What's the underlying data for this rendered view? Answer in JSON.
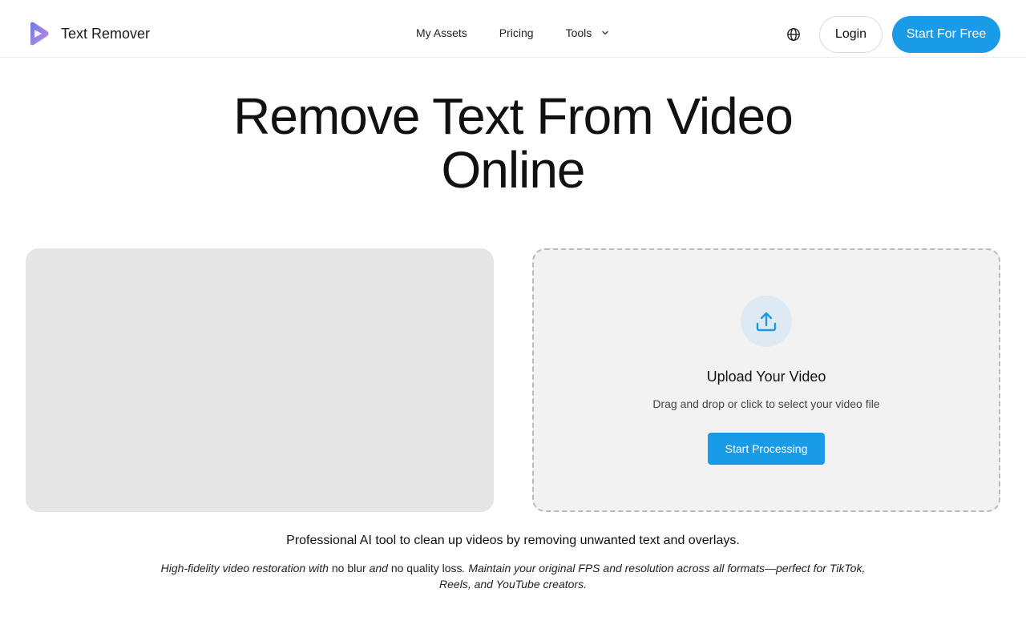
{
  "header": {
    "brand_name": "Text Remover",
    "nav": {
      "my_assets": "My Assets",
      "pricing": "Pricing",
      "tools": "Tools"
    },
    "login_label": "Login",
    "start_label": "Start For Free"
  },
  "hero": {
    "title_line1": "Remove Text From Video",
    "title_line2": "Online"
  },
  "upload": {
    "title": "Upload Your Video",
    "subtitle": "Drag and drop or click to select your video file",
    "button_label": "Start Processing"
  },
  "description": {
    "main": "Professional AI tool to clean up videos by removing unwanted text and overlays.",
    "sub": {
      "part1": "High-fidelity video restoration with ",
      "part2": "no blur",
      "part3": " and ",
      "part4": "no quality loss",
      "part5": ". Maintain your original FPS and resolution across all formats—perfect for TikTok, Reels, and YouTube creators."
    }
  },
  "icons": {
    "logo": "play-logo-icon",
    "globe": "globe-icon",
    "chevron": "chevron-down-icon",
    "upload": "upload-icon"
  },
  "colors": {
    "accent": "#1a9be8",
    "logo_gradient_start": "#6b7be8",
    "logo_gradient_end": "#c48bd9",
    "preview_bg": "#e5e5e5",
    "upload_bg": "#f2f2f2"
  }
}
